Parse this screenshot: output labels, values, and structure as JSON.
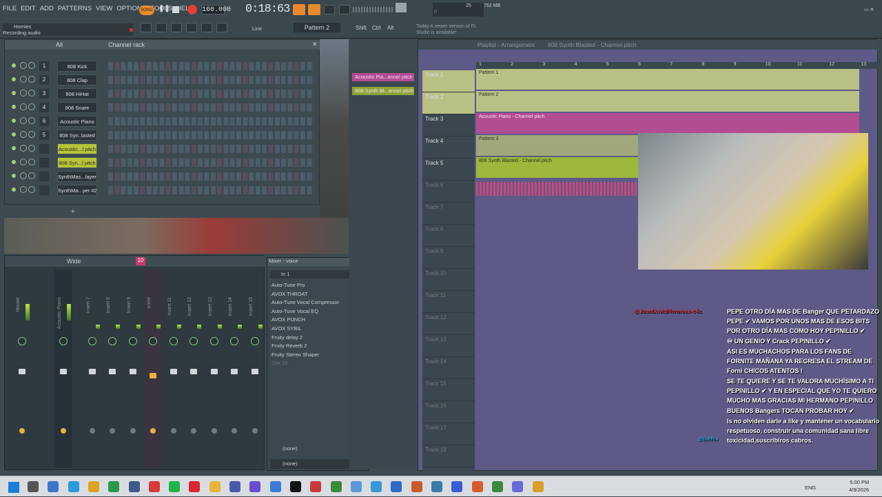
{
  "menu": [
    "FILE",
    "EDIT",
    "ADD",
    "PATTERNS",
    "VIEW",
    "OPTIONS",
    "TOOLS",
    "HELP"
  ],
  "song_mode": "SONG",
  "tempo": "160.000",
  "time": "0:18:63",
  "cpu": "25",
  "memory": "762 MB",
  "memory_sub": "0",
  "project_name": "Homies",
  "status": "Recording audio",
  "snap": "Line",
  "pattern": "Pattern 2",
  "toolbar_buttons": [
    "Shift",
    "Ctrl",
    "Alt"
  ],
  "update_hint": "Today A newer version of FL Studio is available!",
  "rack": {
    "filter": "All",
    "title": "Channel rack",
    "channels": [
      {
        "num": "1",
        "name": "808 Kick",
        "hl": false
      },
      {
        "num": "2",
        "name": "808 Clap",
        "hl": false
      },
      {
        "num": "3",
        "name": "808 HiHat",
        "hl": false
      },
      {
        "num": "4",
        "name": "808 Snare",
        "hl": false
      },
      {
        "num": "6",
        "name": "Acoustic Piano",
        "hl": false
      },
      {
        "num": "5",
        "name": "808 Syn..lasted",
        "hl": false
      },
      {
        "num": "",
        "name": "Acoustic...l pitch",
        "hl": true
      },
      {
        "num": "",
        "name": "808 Syn...l pitch",
        "hl": true
      },
      {
        "num": "",
        "name": "SynthMas...layer",
        "hl": false
      },
      {
        "num": "",
        "name": "SynthMa...yer #2",
        "hl": false
      }
    ],
    "add": "+"
  },
  "mixer": {
    "wide": "Wide",
    "strips": [
      "Master",
      "Acoustic Piano",
      "Insert 7",
      "Insert 8",
      "Insert 9",
      "voice",
      "Insert 11",
      "Insert 12",
      "Insert 13",
      "Insert 14",
      "Insert 15"
    ],
    "selected_num": "10"
  },
  "slots": {
    "title": "Mixer - voice",
    "input": "In 1",
    "items": [
      "Auto-Tune Pro",
      "AVOX THROAT",
      "Auto-Tune Vocal Compressor",
      "Auto-Tune Vocal EQ",
      "AVOX PUNCH",
      "AVOX SYBIL",
      "Fruity delay 2",
      "Fruity Reverb 2",
      "Fruity Stereo Shaper",
      "Slot 10"
    ],
    "out1": "(none)",
    "out2": "(none)"
  },
  "browser_pills": [
    {
      "label": "Acoustic Pia...annel pitch",
      "color": "#b24c93"
    },
    {
      "label": "808 Synth Bl...annel pitch",
      "color": "#8fa43a"
    }
  ],
  "playlist": {
    "title": "Playlist - Arrangement",
    "subtitle": "808 Synth Blasted - Channel pitch",
    "ruler": [
      "1",
      "2",
      "3",
      "4",
      "5",
      "6",
      "7",
      "8",
      "9",
      "10",
      "11",
      "12",
      "13"
    ],
    "tracks": [
      "Track 1",
      "Track 2",
      "Track 3",
      "Track 4",
      "Track 5",
      "Track 6",
      "Track 7",
      "Track 8",
      "Track 9",
      "Track 10",
      "Track 11",
      "Track 12",
      "Track 13",
      "Track 14",
      "Track 15",
      "Track 16",
      "Track 17",
      "Track 18"
    ],
    "clips": {
      "p1": "Pattern 1",
      "p2": "Pattern 2",
      "p3": "Pattern 3",
      "piano": "Acoustic Piano - Channel pitch",
      "synth": "808 Synth Blasted - Channel pitch"
    }
  },
  "chat": {
    "user": "@JuanDavidHermosa-c4c",
    "messages": [
      "PEPE OTRO DÍA MAS DE Banger QUE PETARDAZO PEPE ✔ VAMOS POR UNOS MAS DE ESOS BITS POR OTRO DÍA MAS COMO HOY PEPINILLO ✔",
      "♾ UN GENIO Y Crack PEPINILLO ✔",
      "ASI ES MUCHACHOS PARA LOS FANS DE FORNITE MAÑANA YA REGRESA EL STREAM DE Forni CHICOS ATENTOS !",
      "SE TE QUIERE Y SE TE VALORA MUCHÍSIMO A TI PEPINILLO ✔ Y EN ESPECIAL QUE YO TE QUIERO MUCHO MAS GRACIAS MI HERMANO PEPINILLO",
      "BUENOS Bangers TOCAN PROBAR HOY ✔",
      "ls no olviden darle a like y mantener un vocabulario respetuoso, construir una comunidad sana libre toxicidad,suscribiros cabros."
    ],
    "bot": "@BotRix"
  },
  "tray": {
    "lang": "ENG",
    "time": "5:00 PM",
    "date": "4/9/2026"
  }
}
